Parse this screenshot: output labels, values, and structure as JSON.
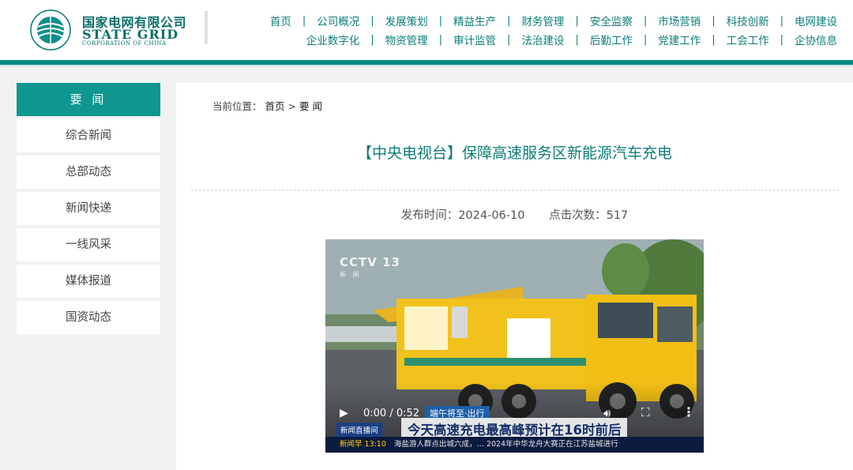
{
  "header": {
    "logo": {
      "cn": "国家电网有限公司",
      "en": "STATE GRID",
      "en_sub": "CORPORATION OF CHINA",
      "emblem_text": "国家电网公司 STATE GRID CORPORATION OF CHINA"
    },
    "nav_row1": [
      "首页",
      "公司概况",
      "发展策划",
      "精益生产",
      "财务管理",
      "安全监察",
      "市场营销",
      "科技创新",
      "电网建设"
    ],
    "nav_row2": [
      "企业数字化",
      "物资管理",
      "审计监管",
      "法治建设",
      "后勤工作",
      "党建工作",
      "工会工作",
      "企协信息"
    ],
    "separator": "|"
  },
  "sidebar": {
    "heading": "要 闻",
    "items": [
      "综合新闻",
      "总部动态",
      "新闻快递",
      "一线风采",
      "媒体报道",
      "国资动态"
    ]
  },
  "breadcrumb": {
    "prefix": "当前位置：",
    "home": "首页",
    "sep": ">",
    "current": "要 闻"
  },
  "article": {
    "title": "【中央电视台】保障高速服务区新能源汽车充电",
    "publish_label": "发布时间：2024-06-10",
    "clicks_label": "点击次数：517"
  },
  "video": {
    "channel": "CCTV 13",
    "channel_sub": "新 闻",
    "caption_tag": "端午将至·出行",
    "live_tag": "新闻直播间",
    "caption_main": "今天高速充电最高峰预计在16时前后",
    "ticker_left": "新闻早 13:10",
    "ticker_text": "海盐游人群点出城六成，… 2024年中华龙舟大赛正在江苏盐城进行",
    "time": "0:00 / 0:52",
    "progress": 0
  },
  "colors": {
    "brand": "#0b8a86",
    "sidebar_head": "#0f9690",
    "title": "#0b7d79"
  }
}
